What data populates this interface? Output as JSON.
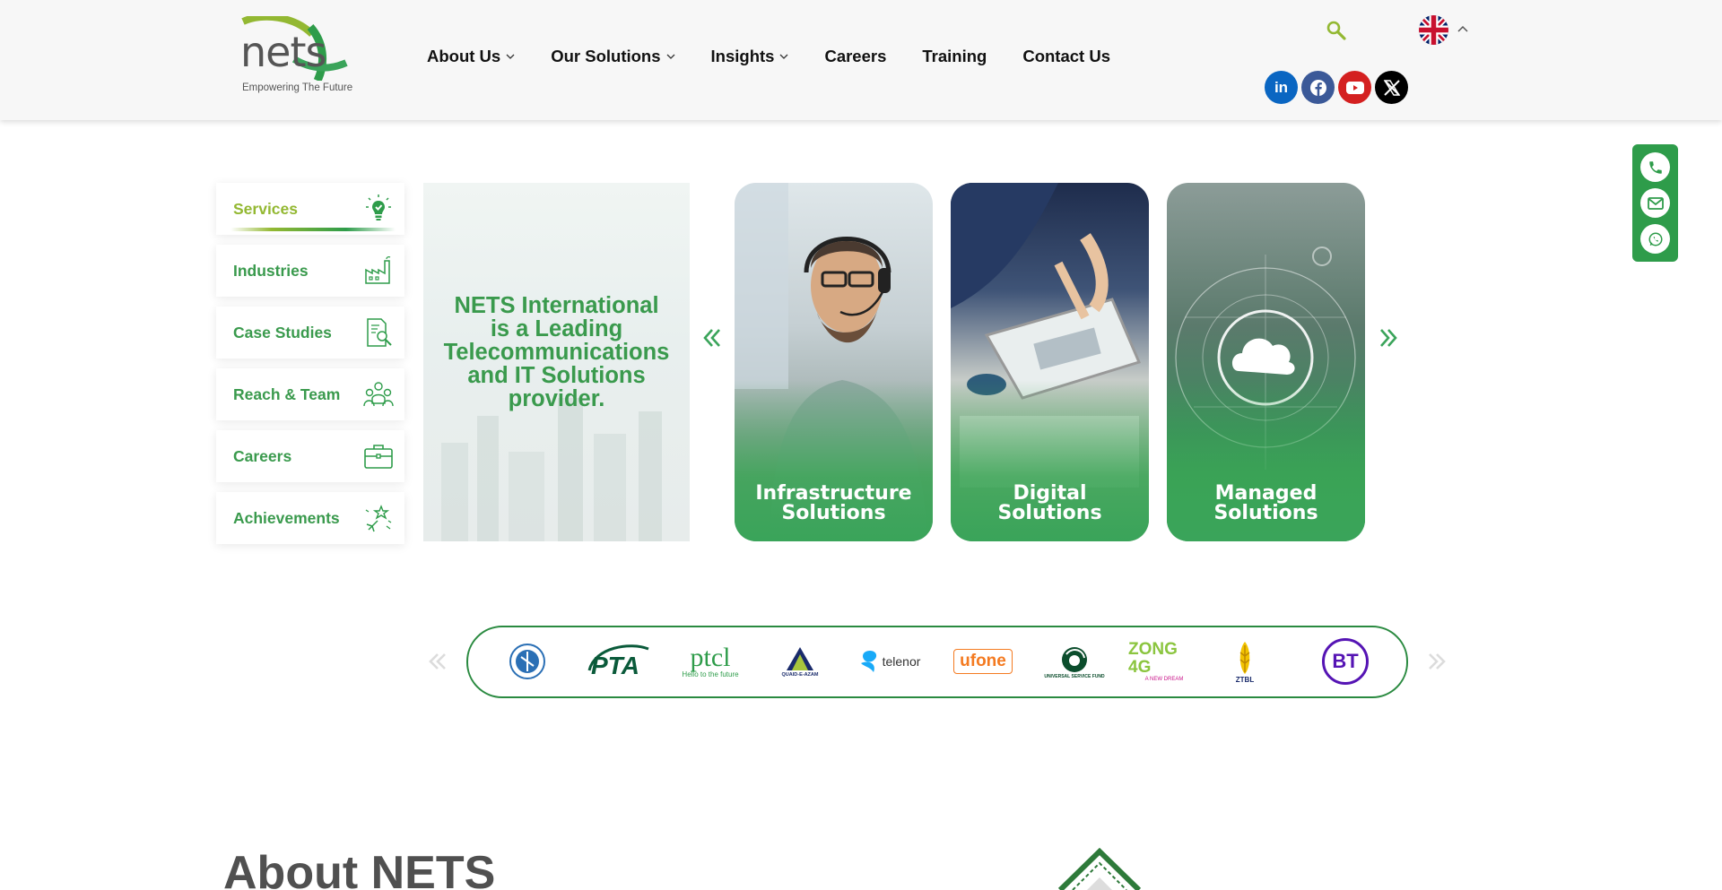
{
  "brand": {
    "name": "nets",
    "tagline": "Empowering The Future",
    "colors": {
      "primary_green": "#2e9c4a",
      "lime": "#93b832",
      "text_dark": "#111111"
    }
  },
  "nav": {
    "items": [
      {
        "label": "About Us",
        "has_dropdown": true
      },
      {
        "label": "Our Solutions",
        "has_dropdown": true
      },
      {
        "label": "Insights",
        "has_dropdown": true
      },
      {
        "label": "Careers",
        "has_dropdown": false
      },
      {
        "label": "Training",
        "has_dropdown": false
      },
      {
        "label": "Contact Us",
        "has_dropdown": false
      }
    ]
  },
  "header_icons": [
    "search-icon",
    "uk-flag-icon",
    "chevron-up-icon"
  ],
  "social": [
    "linkedin-icon",
    "facebook-icon",
    "youtube-icon",
    "x-icon"
  ],
  "float_contact": [
    "phone-icon",
    "email-icon",
    "whatsapp-icon"
  ],
  "sidebar": {
    "items": [
      {
        "label": "Services",
        "icon": "lightbulb-icon",
        "active": true
      },
      {
        "label": "Industries",
        "icon": "factory-icon",
        "active": false
      },
      {
        "label": "Case Studies",
        "icon": "document-search-icon",
        "active": false
      },
      {
        "label": "Reach & Team",
        "icon": "team-icon",
        "active": false
      },
      {
        "label": "Careers",
        "icon": "briefcase-icon",
        "active": false
      },
      {
        "label": "Achievements",
        "icon": "award-icon",
        "active": false
      }
    ]
  },
  "hero": {
    "line1": "NETS International",
    "line2": "is a Leading",
    "line3": "Telecommunications",
    "line4": "and IT Solutions",
    "line5": "provider."
  },
  "solutions": {
    "cards": [
      {
        "line1": "Infrastructure",
        "line2": "Solutions"
      },
      {
        "line1": "Digital",
        "line2": "Solutions"
      },
      {
        "line1": "Managed",
        "line2": "Solutions"
      }
    ]
  },
  "clients": {
    "logos": [
      {
        "name": "pakistan-telecom-seal",
        "text": ""
      },
      {
        "name": "pta",
        "text": "PTA"
      },
      {
        "name": "ptcl",
        "text": "ptcl",
        "sub": "Hello to the future"
      },
      {
        "name": "quaid-e-azam",
        "text": "QUAID-E-AZAM"
      },
      {
        "name": "telenor",
        "text": "telenor"
      },
      {
        "name": "ufone",
        "text": "ufone"
      },
      {
        "name": "usf",
        "text": "UNIVERSAL SERVICE FUND"
      },
      {
        "name": "zong",
        "text": "ZONG 4G",
        "sub": "A NEW DREAM"
      },
      {
        "name": "ztbl",
        "text": "ZTBL"
      },
      {
        "name": "bt",
        "text": "BT"
      }
    ]
  },
  "about": {
    "title": "About NETS"
  }
}
